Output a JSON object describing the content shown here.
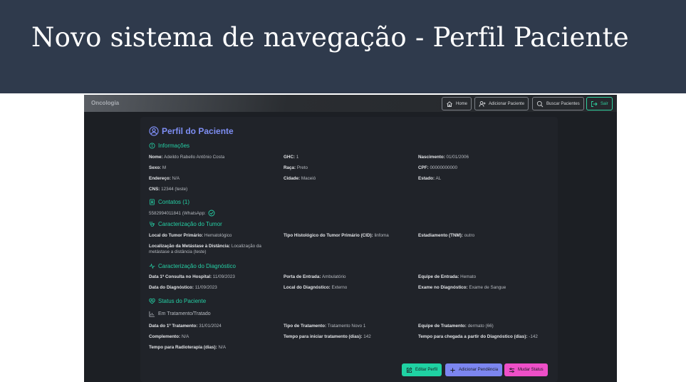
{
  "slide": {
    "title": "Novo sistema de navegação - Perfil Paciente"
  },
  "navbar": {
    "brand": "Oncologia",
    "home": "Home",
    "add_patient": "Adicionar Paciente",
    "search_patients": "Buscar Pacientes",
    "exit": "Sair"
  },
  "profile": {
    "title": "Perfil do Paciente",
    "info": {
      "heading": "Informações",
      "name_label": "Nome:",
      "name": "Adeildo Rabello Antônio Costa",
      "ghc_label": "GHC:",
      "ghc": "1",
      "birth_label": "Nascimento:",
      "birth": "01/01/2006",
      "sex_label": "Sexo:",
      "sex": "M",
      "race_label": "Raça:",
      "race": "Preto",
      "cpf_label": "CPF:",
      "cpf": "00000000000",
      "address_label": "Endereço:",
      "address": "N/A",
      "city_label": "Cidade:",
      "city": "Maceió",
      "state_label": "Estado:",
      "state": "AL",
      "cns_label": "CNS:",
      "cns": "12344 (teste)"
    },
    "contacts": {
      "heading": "Contatos (1)",
      "phone": "5582994011841 (WhatsApp:"
    },
    "tumor": {
      "heading": "Caracterização do Tumor",
      "primary_label": "Local do Tumor Primário:",
      "primary": "Hematológico",
      "histo_label": "Tipo Histológico do Tumor Primário (CID):",
      "histo": "linfoma",
      "staging_label": "Estadiamento (TNM):",
      "staging": "outro",
      "meta_label": "Localização da Metástase à Distância:",
      "meta": "Localização da metástase a distância (teste)"
    },
    "diagnosis": {
      "heading": "Caracterização do Diagnóstico",
      "first_visit_label": "Data 1ª Consulta no Hospital:",
      "first_visit": "11/09/2023",
      "entry_label": "Porta de Entrada:",
      "entry": "Ambulatório",
      "team_label": "Equipe de Entrada:",
      "team": "Hemato",
      "date_label": "Data do Diagnóstico:",
      "date": "11/09/2023",
      "place_label": "Local do Diagnóstico:",
      "place": "Externo",
      "exam_label": "Exame no Diagnóstico:",
      "exam": "Exame de Sangue"
    },
    "status": {
      "heading": "Status do Paciente",
      "value": "Em Tratamento/Tratado",
      "first_treat_label": "Data do 1º Tratamento:",
      "first_treat": "31/01/2024",
      "treat_type_label": "Tipo de Tratamento:",
      "treat_type": "Tratamento Novo 1",
      "treat_team_label": "Equipe de Tratamento:",
      "treat_team": "dermato (66)",
      "complement_label": "Complemento:",
      "complement": "N/A",
      "days_start_label": "Tempo para iniciar tratamento (dias):",
      "days_start": "142",
      "days_diag_label": "Tempo para chegada a partir do Diagnóstico (dias):",
      "days_diag": "-142",
      "radio_label": "Tempo para Radioterapia (dias):",
      "radio": "N/A"
    },
    "actions": {
      "edit": "Editar Perfil",
      "pending": "Adicionar Pendência",
      "status": "Mudar Status"
    }
  },
  "colors": {
    "accent_teal": "#25d0a5",
    "accent_purple": "#7e8ef3",
    "accent_pink": "#ee4fc8",
    "header_bg": "#2f3a4c"
  }
}
